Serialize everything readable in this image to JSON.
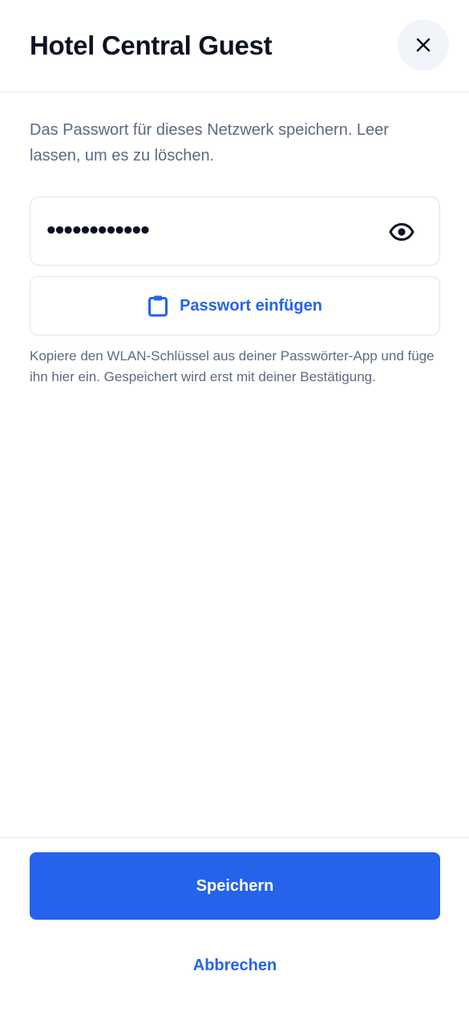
{
  "dialog": {
    "title": "Hotel Central Guest",
    "close_icon": "close-icon"
  },
  "description": "Das Passwort für dieses Netzwerk speichern. Leer lassen, um es zu löschen.",
  "password_field": {
    "masked_value": "••••••••••••",
    "toggle_icon": "eye-icon"
  },
  "paste_button": {
    "label": "Passwort einfügen",
    "icon": "clipboard-icon"
  },
  "hint": "Kopiere den WLAN-Schlüssel aus deiner Passwörter-App und füge ihn hier ein. Gespeichert wird erst mit deiner Bestätigung.",
  "footer": {
    "save_label": "Speichern",
    "cancel_label": "Abbrechen"
  },
  "colors": {
    "accent": "#2563eb",
    "muted_text": "#5b6b80",
    "border": "#dfe3e8"
  }
}
